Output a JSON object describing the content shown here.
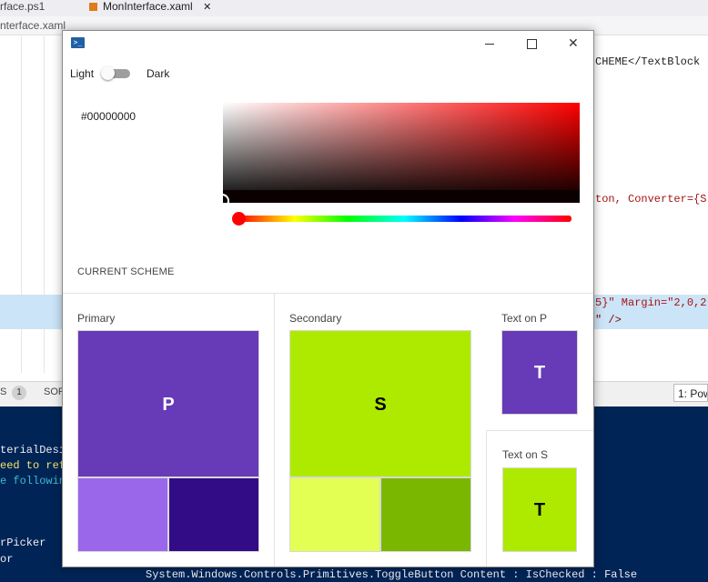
{
  "background_editor": {
    "tab1": "rface.ps1",
    "tab2": "MonInterface.xaml",
    "tab2_close": "✕",
    "breadcrumb": "nterface.xaml",
    "code_lines": [
      {
        "text": "CHEME</TextBlock"
      },
      {
        "text": "ton, Converter={S"
      },
      {
        "text": "5}\" Margin=\"2,0,2"
      },
      {
        "text": "\" />"
      }
    ],
    "problems_count": "1",
    "problems_prefix": "S",
    "sort_label": "SOR",
    "terminal_dropdown": "1: Pow",
    "terminal_lines": [
      {
        "text": "terialDesi",
        "color": "#eeedf0"
      },
      {
        "text": "eed to ref",
        "color": "#f0e66a"
      },
      {
        "text": "e followin",
        "color": "#3dbcd2"
      },
      {
        "text": "rPicker",
        "color": "#eeedf0"
      },
      {
        "text": "or",
        "color": "#eeedf0"
      },
      {
        "text": "System.Windows.Controls.Primitives.ToggleButton Content :  IsChecked : False",
        "color": "#eeedf0"
      }
    ]
  },
  "dialog": {
    "titlebar": {
      "icon": "powershell-icon",
      "minimize": "minimize-icon",
      "maximize": "maximize-icon",
      "close": "close-icon",
      "close_glyph": "✕"
    },
    "theme_toggle": {
      "light_label": "Light",
      "dark_label": "Dark",
      "is_dark": false
    },
    "color_picker": {
      "hex_value": "#00000000",
      "hue": 0,
      "selected_color": "#000000"
    },
    "current_scheme": {
      "label": "CURRENT SCHEME",
      "primary": {
        "label": "Primary",
        "letter": "P",
        "main": "#673ab7",
        "light": "#9a67ea",
        "dark": "#320b86"
      },
      "secondary": {
        "label": "Secondary",
        "letter": "S",
        "main": "#aeea00",
        "light": "#e4ff54",
        "dark": "#79b700"
      },
      "text_on_primary": {
        "label": "Text on P",
        "letter": "T",
        "background": "#673ab7",
        "foreground": "#ffffff"
      },
      "text_on_secondary": {
        "label": "Text on S",
        "letter": "T",
        "background": "#aeea00",
        "foreground": "#000000"
      }
    }
  }
}
